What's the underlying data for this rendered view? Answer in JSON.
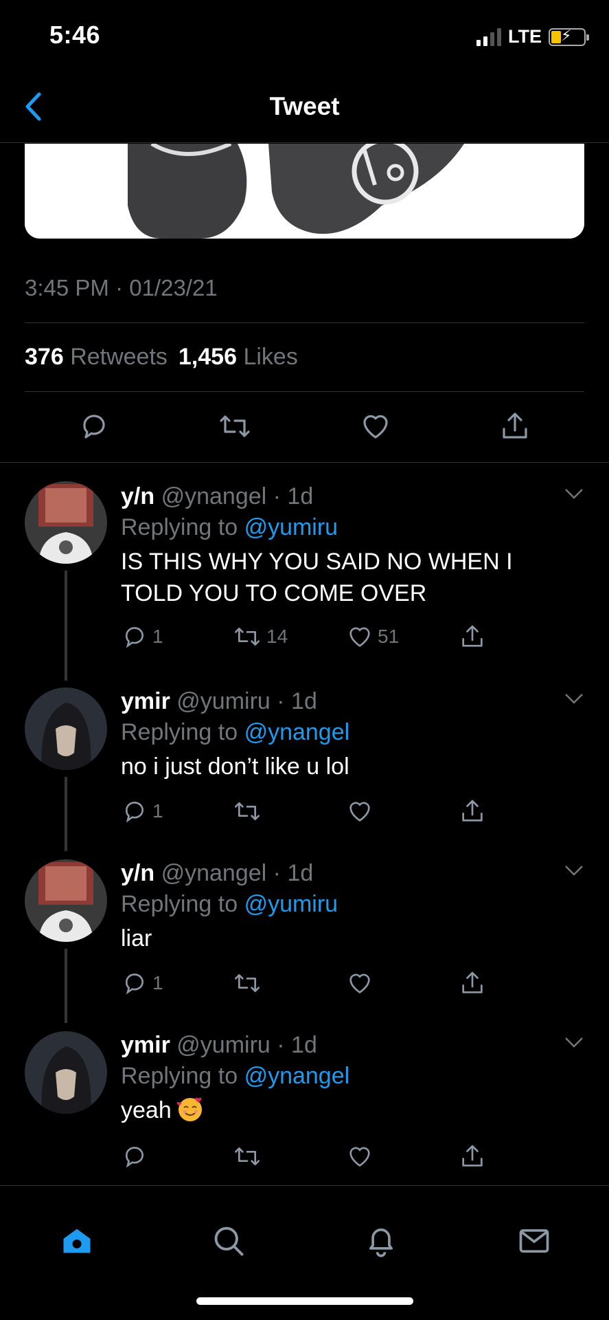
{
  "status_bar": {
    "time": "5:46",
    "network": "LTE"
  },
  "header": {
    "title": "Tweet"
  },
  "tweet": {
    "timestamp": "3:45 PM · 01/23/21",
    "retweets_count": "376",
    "retweets_label": "Retweets",
    "likes_count": "1,456",
    "likes_label": "Likes"
  },
  "replies": [
    {
      "name": "y/n",
      "handle": "@ynangel",
      "time": "· 1d",
      "replying_prefix": "Replying to",
      "replying_to": "@yumiru",
      "text_line1": "IS THIS WHY YOU SAID NO WHEN I",
      "text_line2": "TOLD YOU TO COME OVER",
      "reply_count": "1",
      "retweet_count": "14",
      "like_count": "51"
    },
    {
      "name": "ymir",
      "handle": "@yumiru",
      "time": "· 1d",
      "replying_prefix": "Replying to",
      "replying_to": "@ynangel",
      "text": "no i just don’t like u lol",
      "reply_count": "1"
    },
    {
      "name": "y/n",
      "handle": "@ynangel",
      "time": "· 1d",
      "replying_prefix": "Replying to",
      "replying_to": "@yumiru",
      "text": "liar",
      "reply_count": "1"
    },
    {
      "name": "ymir",
      "handle": "@yumiru",
      "time": "· 1d",
      "replying_prefix": "Replying to",
      "replying_to": "@ynangel",
      "text": "yeah",
      "emoji": "smiling-face-with-hearts"
    }
  ],
  "tabs": [
    "home-icon",
    "search-icon",
    "notifications-icon",
    "messages-icon"
  ],
  "colors": {
    "accent": "#1d9bf0",
    "muted": "#71767b",
    "divider": "#2f3336",
    "background": "#000000"
  }
}
